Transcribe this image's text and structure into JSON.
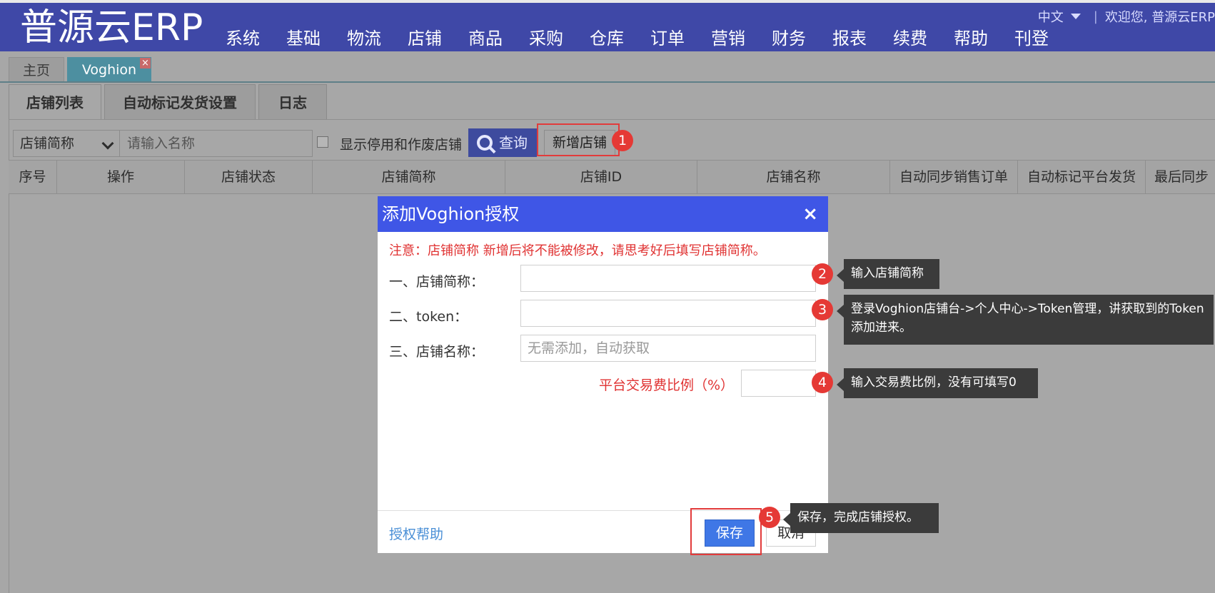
{
  "header": {
    "logo": "普源云ERP",
    "nav": [
      "系统",
      "基础",
      "物流",
      "店铺",
      "商品",
      "采购",
      "仓库",
      "订单",
      "营销",
      "财务",
      "报表",
      "续费",
      "帮助",
      "刊登"
    ],
    "language": "中文",
    "separator": "|",
    "welcome": "欢迎您, 普源云ERP"
  },
  "page_tabs": {
    "home": "主页",
    "active": "Voghion",
    "close_glyph": "×"
  },
  "sub_tabs": [
    "店铺列表",
    "自动标记发货设置",
    "日志"
  ],
  "toolbar": {
    "select_value": "店铺简称",
    "search_placeholder": "请输入名称",
    "show_disabled_label": "显示停用和作废店铺",
    "query_label": "查询",
    "add_label": "新增店铺"
  },
  "table": {
    "columns": [
      "序号",
      "操作",
      "店铺状态",
      "店铺简称",
      "店铺ID",
      "店铺名称",
      "自动同步销售订单",
      "自动标记平台发货",
      "最后同步"
    ]
  },
  "modal": {
    "title": "添加Voghion授权",
    "close_glyph": "×",
    "notice": "注意：店铺简称 新增后将不能被修改，请思考好后填写店铺简称。",
    "fields": {
      "shop_abbr_label": "一、店铺简称：",
      "token_label": "二、token：",
      "shop_name_label": "三、店铺名称：",
      "shop_name_placeholder": "无需添加，自动获取",
      "fee_label": "平台交易费比例（%）"
    },
    "help_link": "授权帮助",
    "save_label": "保存",
    "cancel_label": "取消"
  },
  "annotations": {
    "badges": [
      "1",
      "2",
      "3",
      "4",
      "5"
    ],
    "tips": {
      "t2": "输入店铺简称",
      "t3": "登录Voghion店铺台->个人中心->Token管理，讲获取到的Token添加进来。",
      "t4": "输入交易费比例，没有可填写0",
      "t5": "保存，完成店铺授权。"
    },
    "highlight_color": "#e23b3b",
    "badge_color": "#e53935"
  },
  "colors": {
    "header_bg": "#3f48a7",
    "modal_header_bg": "#3f56e6",
    "save_bg": "#3f77e6",
    "notice": "#e03232",
    "link": "#4a8fd6"
  }
}
